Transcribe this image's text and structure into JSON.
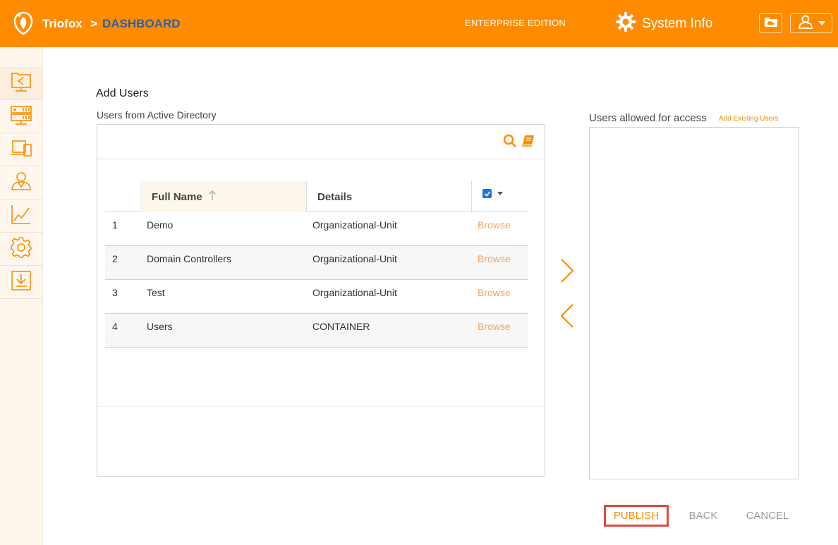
{
  "header": {
    "brand": "Triofox",
    "separator": ">",
    "breadcrumb": "DASHBOARD",
    "edition": "ENTERPRISE EDITION",
    "system_info": "System Info"
  },
  "sidebar": {
    "items": [
      {
        "icon": "share-folder-icon",
        "active": true
      },
      {
        "icon": "server-icon",
        "active": false
      },
      {
        "icon": "devices-icon",
        "active": false
      },
      {
        "icon": "user-icon",
        "active": false
      },
      {
        "icon": "chart-icon",
        "active": false
      },
      {
        "icon": "settings-icon",
        "active": false
      },
      {
        "icon": "download-icon",
        "active": false
      }
    ]
  },
  "page": {
    "title": "Add Users",
    "subtitle": "Users from Active Directory"
  },
  "grid": {
    "columns": {
      "name": "Full Name",
      "details": "Details"
    },
    "rows": [
      {
        "index": "1",
        "name": "Demo",
        "details": "Organizational-Unit",
        "action": "Browse"
      },
      {
        "index": "2",
        "name": "Domain Controllers",
        "details": "Organizational-Unit",
        "action": "Browse"
      },
      {
        "index": "3",
        "name": "Test",
        "details": "Organizational-Unit",
        "action": "Browse"
      },
      {
        "index": "4",
        "name": "Users",
        "details": "CONTAINER",
        "action": "Browse"
      }
    ]
  },
  "right": {
    "title": "Users allowed for access",
    "add_existing": "Add Existing Users"
  },
  "actions": {
    "publish": "PUBLISH",
    "back": "BACK",
    "cancel": "CANCEL"
  },
  "colors": {
    "accent": "#ff8c00",
    "breadcrumb": "#2f5f9e",
    "browse_link": "#f5a35a",
    "highlight_border": "#e0483b"
  }
}
